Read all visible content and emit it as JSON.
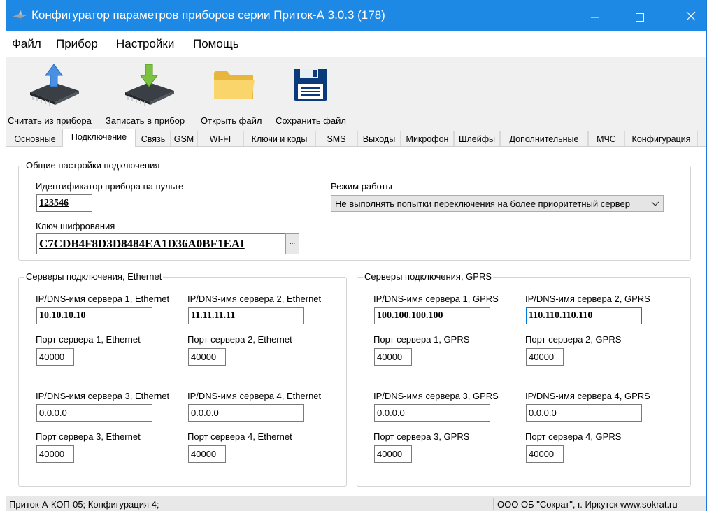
{
  "window": {
    "title": "Конфигуратор параметров приборов серии Приток-А   3.0.3 (178)",
    "title_color": "#1e88e5"
  },
  "menu": [
    "Файл",
    "Прибор",
    "Настройки",
    "Помощь"
  ],
  "toolbar": {
    "read": "Считать из прибора",
    "write": "Записать в прибор",
    "open": "Открыть файл",
    "save": "Сохранить файл"
  },
  "tabs": [
    "Основные",
    "Подключение",
    "Связь",
    "GSM",
    "WI-FI",
    "Ключи и коды",
    "SMS",
    "Выходы",
    "Микрофон",
    "Шлейфы",
    "Дополнительные",
    "МЧС",
    "Конфигурация"
  ],
  "active_tab": "Подключение",
  "general": {
    "title": "Общие настройки подключения",
    "device_id_label": "Идентификатор прибора на пульте",
    "device_id": "123546",
    "key_label": "Ключ шифрования",
    "key": "C7CDB4F8D3D8484EA1D36A0BF1EAI",
    "key_button": "...",
    "mode_label": "Режим работы",
    "mode_value": "Не выполнять попытки переключения на более приоритетный сервер"
  },
  "ethernet": {
    "title": "Серверы подключения, Ethernet",
    "servers": [
      {
        "host_label": "IP/DNS-имя сервера 1, Ethernet",
        "host": "10.10.10.10",
        "port_label": "Порт сервера 1, Ethernet",
        "port": "40000"
      },
      {
        "host_label": "IP/DNS-имя сервера 2, Ethernet",
        "host": "11.11.11.11",
        "port_label": "Порт сервера 2, Ethernet",
        "port": "40000"
      },
      {
        "host_label": "IP/DNS-имя сервера 3, Ethernet",
        "host": "0.0.0.0",
        "port_label": "Порт сервера 3, Ethernet",
        "port": "40000"
      },
      {
        "host_label": "IP/DNS-имя сервера 4, Ethernet",
        "host": "0.0.0.0",
        "port_label": "Порт сервера 4, Ethernet",
        "port": "40000"
      }
    ]
  },
  "gprs": {
    "title": "Серверы подключения, GPRS",
    "servers": [
      {
        "host_label": "IP/DNS-имя сервера 1, GPRS",
        "host": "100.100.100.100",
        "port_label": "Порт сервера 1, GPRS",
        "port": "40000"
      },
      {
        "host_label": "IP/DNS-имя сервера 2, GPRS",
        "host": "110.110.110.110",
        "port_label": "Порт сервера 2, GPRS",
        "port": "40000"
      },
      {
        "host_label": "IP/DNS-имя сервера 3, GPRS",
        "host": "0.0.0.0",
        "port_label": "Порт сервера 3, GPRS",
        "port": "40000"
      },
      {
        "host_label": "IP/DNS-имя сервера 4, GPRS",
        "host": "0.0.0.0",
        "port_label": "Порт сервера 4, GPRS",
        "port": "40000"
      }
    ]
  },
  "status": {
    "left": "Приток-А-КОП-05; Конфигурация 4;",
    "right": "ООО ОБ \"Сократ\", г. Иркутск   www.sokrat.ru"
  }
}
